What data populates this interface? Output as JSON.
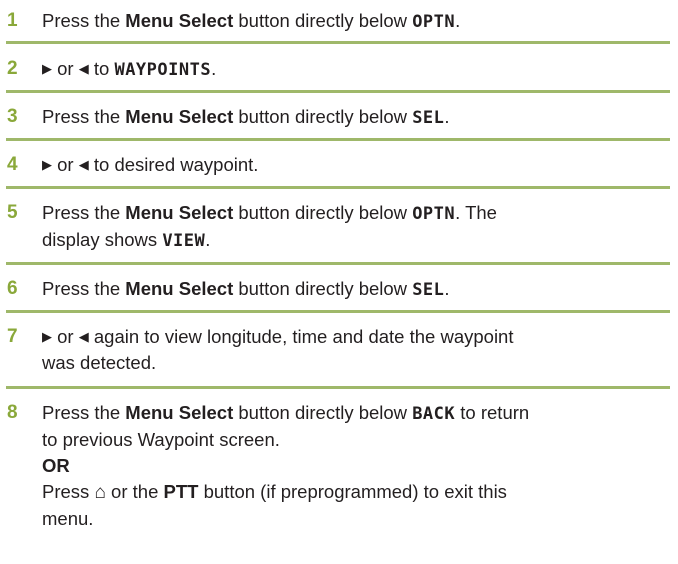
{
  "steps": [
    {
      "num": "1",
      "parts": [
        "Press the ",
        "Menu Select",
        " button directly below ",
        "OPTN",
        "."
      ]
    },
    {
      "num": "2",
      "parts": [
        "▶",
        " or ",
        "◀",
        " to ",
        "WAYPOINTS",
        "."
      ]
    },
    {
      "num": "3",
      "parts": [
        "Press the ",
        "Menu Select",
        " button directly below ",
        "SEL",
        "."
      ]
    },
    {
      "num": "4",
      "parts": [
        "▶",
        " or ",
        "◀",
        " to desired waypoint."
      ]
    },
    {
      "num": "5",
      "parts": [
        "Press the ",
        "Menu Select",
        " button directly below ",
        "OPTN",
        ". The",
        "display shows ",
        "VIEW",
        "."
      ]
    },
    {
      "num": "6",
      "parts": [
        "Press the ",
        "Menu Select",
        " button directly below ",
        "SEL",
        "."
      ]
    },
    {
      "num": "7",
      "parts": [
        "▶",
        " or ",
        "◀",
        " again to view longitude, time and date the waypoint",
        "was detected."
      ]
    },
    {
      "num": "8",
      "parts": [
        "Press the ",
        "Menu Select",
        " button directly below ",
        "BACK",
        " to return",
        "to previous Waypoint screen.",
        "OR",
        "Press ",
        "⌂",
        " or the ",
        "PTT",
        " button (if preprogrammed) to exit this",
        "menu."
      ]
    }
  ],
  "icons": {
    "right": "right-arrow-icon",
    "left": "left-arrow-icon",
    "home": "home-icon"
  },
  "colors": {
    "step_number": "#8aa83a",
    "divider": "#9fb86a",
    "text": "#231f20"
  }
}
